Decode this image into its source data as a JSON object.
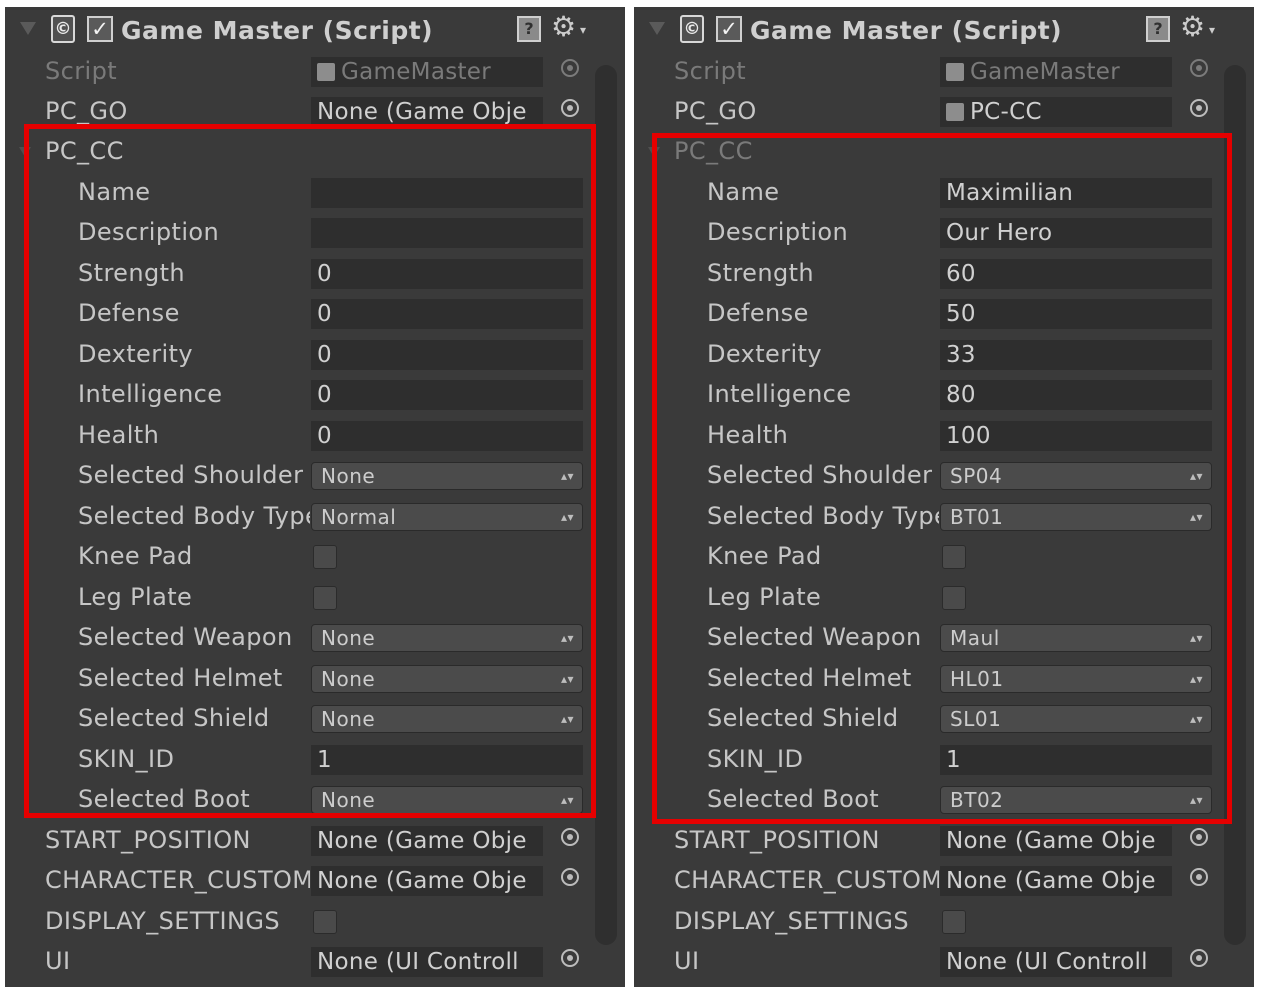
{
  "panels": [
    {
      "header": {
        "title": "Game Master (Script)",
        "script_glyph": "©",
        "check_glyph": "✓",
        "help_glyph": "?",
        "gear_glyph": "⚙",
        "caret_glyph": "▾"
      },
      "script_label": "Script",
      "script_value": "GameMaster",
      "pc_go": {
        "label": "PC_GO",
        "value": "None (Game Obje"
      },
      "pc_cc": {
        "label": "PC_CC",
        "name": {
          "label": "Name",
          "value": ""
        },
        "description": {
          "label": "Description",
          "value": ""
        },
        "strength": {
          "label": "Strength",
          "value": "0"
        },
        "defense": {
          "label": "Defense",
          "value": "0"
        },
        "dexterity": {
          "label": "Dexterity",
          "value": "0"
        },
        "intelligence": {
          "label": "Intelligence",
          "value": "0"
        },
        "health": {
          "label": "Health",
          "value": "0"
        },
        "selected_shoulder": {
          "label": "Selected Shoulder",
          "value": "None"
        },
        "selected_body_type": {
          "label": "Selected Body Type",
          "value": "Normal"
        },
        "knee_pad": {
          "label": "Knee Pad",
          "checked": false
        },
        "leg_plate": {
          "label": "Leg Plate",
          "checked": false
        },
        "selected_weapon": {
          "label": "Selected Weapon",
          "value": "None"
        },
        "selected_helmet": {
          "label": "Selected Helmet",
          "value": "None"
        },
        "selected_shield": {
          "label": "Selected Shield",
          "value": "None"
        },
        "skin_id": {
          "label": "SKIN_ID",
          "value": "1"
        },
        "selected_boot": {
          "label": "Selected Boot",
          "value": "None"
        }
      },
      "start_position": {
        "label": "START_POSITION",
        "value": "None (Game Obje"
      },
      "character_custom": {
        "label": "CHARACTER_CUSTOM",
        "value": "None (Game Obje"
      },
      "display_settings": {
        "label": "DISPLAY_SETTINGS",
        "checked": false
      },
      "ui": {
        "label": "UI",
        "value": "None (UI Controll"
      },
      "dropdown_arrow": "▴▾",
      "highlight_color": "#e50000"
    },
    {
      "header": {
        "title": "Game Master (Script)",
        "script_glyph": "©",
        "check_glyph": "✓",
        "help_glyph": "?",
        "gear_glyph": "⚙",
        "caret_glyph": "▾"
      },
      "script_label": "Script",
      "script_value": "GameMaster",
      "pc_go": {
        "label": "PC_GO",
        "value": "PC-CC"
      },
      "pc_cc": {
        "label": "PC_CC",
        "name": {
          "label": "Name",
          "value": "Maximilian"
        },
        "description": {
          "label": "Description",
          "value": "Our Hero"
        },
        "strength": {
          "label": "Strength",
          "value": "60"
        },
        "defense": {
          "label": "Defense",
          "value": "50"
        },
        "dexterity": {
          "label": "Dexterity",
          "value": "33"
        },
        "intelligence": {
          "label": "Intelligence",
          "value": "80"
        },
        "health": {
          "label": "Health",
          "value": "100"
        },
        "selected_shoulder": {
          "label": "Selected Shoulder",
          "value": "SP04"
        },
        "selected_body_type": {
          "label": "Selected Body Type",
          "value": "BT01"
        },
        "knee_pad": {
          "label": "Knee Pad",
          "checked": false
        },
        "leg_plate": {
          "label": "Leg Plate",
          "checked": false
        },
        "selected_weapon": {
          "label": "Selected Weapon",
          "value": "Maul"
        },
        "selected_helmet": {
          "label": "Selected Helmet",
          "value": "HL01"
        },
        "selected_shield": {
          "label": "Selected Shield",
          "value": "SL01"
        },
        "skin_id": {
          "label": "SKIN_ID",
          "value": "1"
        },
        "selected_boot": {
          "label": "Selected Boot",
          "value": "BT02"
        }
      },
      "start_position": {
        "label": "START_POSITION",
        "value": "None (Game Obje"
      },
      "character_custom": {
        "label": "CHARACTER_CUSTOM",
        "value": "None (Game Obje"
      },
      "display_settings": {
        "label": "DISPLAY_SETTINGS",
        "checked": false
      },
      "ui": {
        "label": "UI",
        "value": "None (UI Controll"
      },
      "dropdown_arrow": "▴▾",
      "highlight_color": "#e50000"
    }
  ]
}
